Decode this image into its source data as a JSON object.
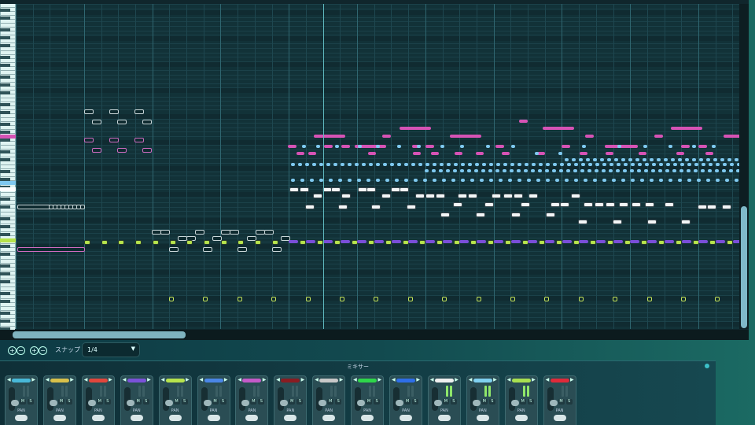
{
  "toolbar": {
    "snap_label": "スナップ",
    "snap_value": "1/4",
    "zoom_buttons": [
      "+",
      "−",
      "+",
      "−"
    ]
  },
  "mixer": {
    "title": "ミキサー",
    "strip_labels": {
      "mute": "M",
      "solo": "S",
      "pan": "PAN"
    },
    "channels": [
      {
        "color": "#48b8d8"
      },
      {
        "color": "#d8c04a"
      },
      {
        "color": "#e2463c"
      },
      {
        "color": "#7a52d8"
      },
      {
        "color": "#b6e34c"
      },
      {
        "color": "#4a86e6"
      },
      {
        "color": "#c45ac8"
      },
      {
        "color": "#8a1c22"
      },
      {
        "color": "#c8c8c8"
      },
      {
        "color": "#2ed64a"
      },
      {
        "color": "#2e6ee8"
      },
      {
        "color": "#f0f0f0"
      },
      {
        "color": "#7fd0f0"
      },
      {
        "color": "#a8e050"
      },
      {
        "color": "#e02a3a"
      }
    ]
  },
  "colors": {
    "note_white": "#f3f6f7",
    "note_pink": "#d653b5",
    "note_blue": "#7fc9f0",
    "note_purple": "#7a4ed8",
    "note_lime": "#b6e34c",
    "playhead": "#5fb9bf"
  }
}
